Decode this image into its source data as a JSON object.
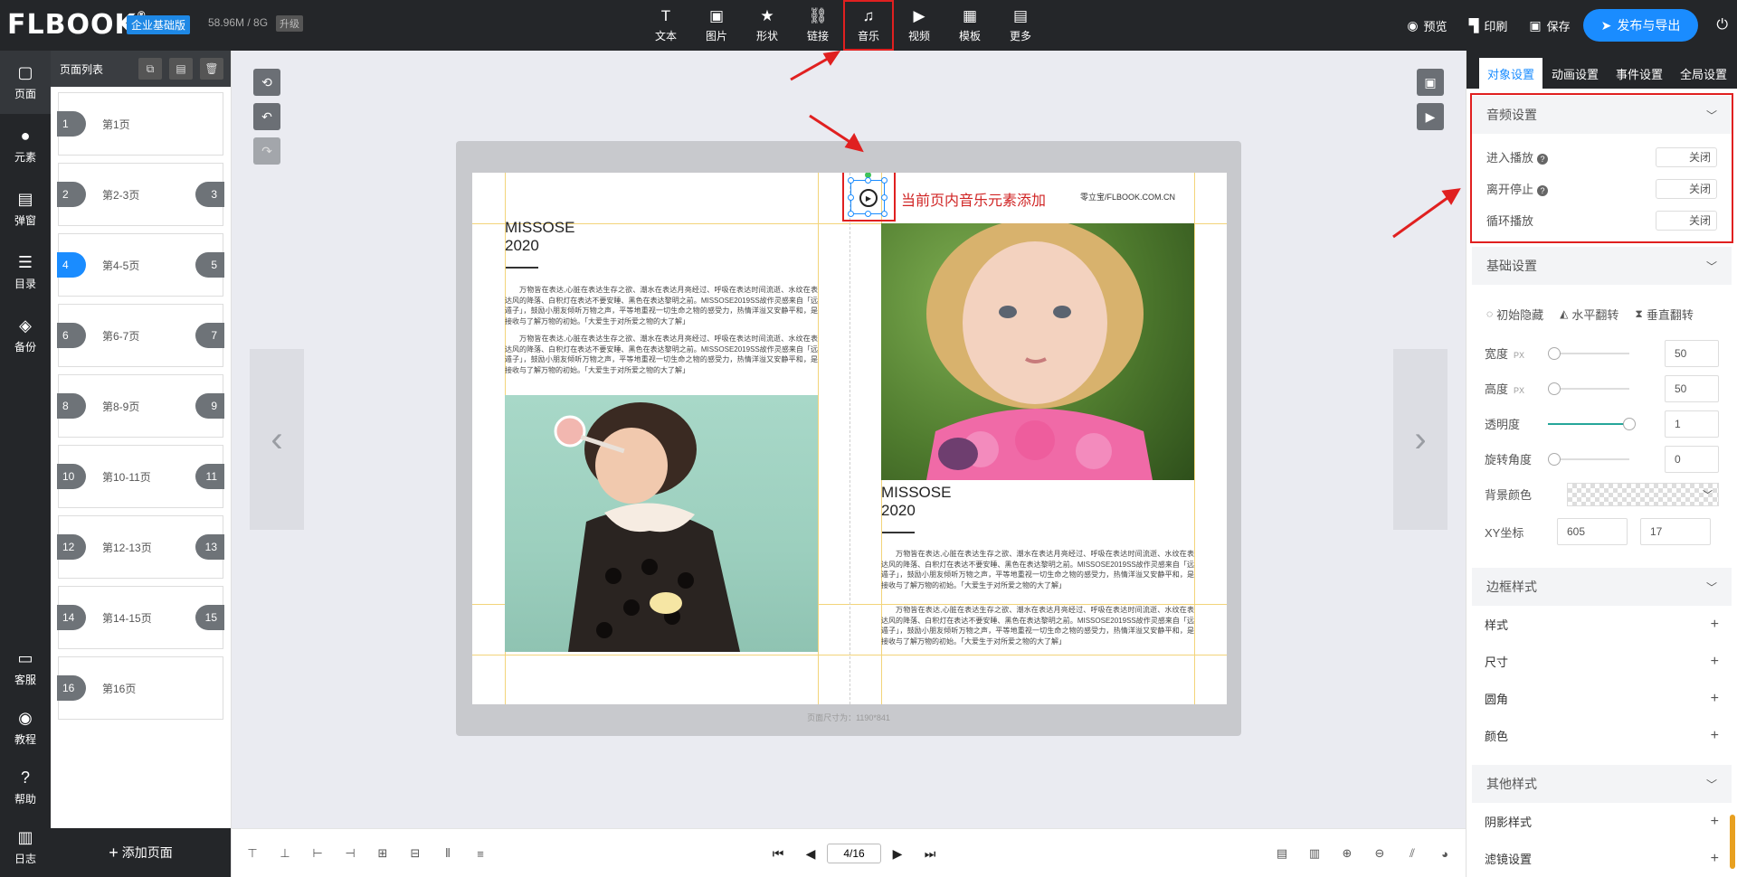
{
  "app": {
    "logo": "FLBOOK",
    "logo_mark": "®",
    "edition": "企业基础版",
    "storage": "58.96M / 8G",
    "upgrade": "升级"
  },
  "toolbar": {
    "items": [
      {
        "label": "文本",
        "icon": "text-icon",
        "glyph": "T"
      },
      {
        "label": "图片",
        "icon": "image-icon",
        "glyph": "▣"
      },
      {
        "label": "形状",
        "icon": "star-icon",
        "glyph": "★"
      },
      {
        "label": "链接",
        "icon": "link-icon",
        "glyph": "⛓"
      },
      {
        "label": "音乐",
        "icon": "music-icon",
        "glyph": "♫"
      },
      {
        "label": "视频",
        "icon": "video-icon",
        "glyph": "▶"
      },
      {
        "label": "模板",
        "icon": "template-icon",
        "glyph": "▦"
      },
      {
        "label": "更多",
        "icon": "more-icon",
        "glyph": "▤"
      }
    ],
    "preview": "预览",
    "print": "印刷",
    "save": "保存",
    "publish": "发布与导出"
  },
  "rail": {
    "top": [
      {
        "label": "页面",
        "icon": "page-icon",
        "glyph": "▢"
      },
      {
        "label": "元素",
        "icon": "elements-icon",
        "glyph": "●"
      },
      {
        "label": "弹窗",
        "icon": "popup-icon",
        "glyph": "▤"
      },
      {
        "label": "目录",
        "icon": "catalog-icon",
        "glyph": "☰"
      },
      {
        "label": "备份",
        "icon": "backup-icon",
        "glyph": "◈"
      }
    ],
    "bottom": [
      {
        "label": "客服",
        "icon": "service-icon",
        "glyph": "▭"
      },
      {
        "label": "教程",
        "icon": "tutorial-icon",
        "glyph": "◉"
      },
      {
        "label": "帮助",
        "icon": "help-icon",
        "glyph": "?"
      },
      {
        "label": "日志",
        "icon": "log-icon",
        "glyph": "▥"
      }
    ]
  },
  "pagelist": {
    "title": "页面列表",
    "items": [
      {
        "num": "1",
        "num2": "",
        "label": "第1页"
      },
      {
        "num": "2",
        "num2": "3",
        "label": "第2-3页"
      },
      {
        "num": "4",
        "num2": "5",
        "label": "第4-5页"
      },
      {
        "num": "6",
        "num2": "7",
        "label": "第6-7页"
      },
      {
        "num": "8",
        "num2": "9",
        "label": "第8-9页"
      },
      {
        "num": "10",
        "num2": "11",
        "label": "第10-11页"
      },
      {
        "num": "12",
        "num2": "13",
        "label": "第12-13页"
      },
      {
        "num": "14",
        "num2": "15",
        "label": "第14-15页"
      },
      {
        "num": "16",
        "num2": "",
        "label": "第16页"
      }
    ],
    "active_index": 2,
    "add_page": "添加页面"
  },
  "canvas": {
    "annotation": "当前页内音乐元素添加",
    "site": "零立宝/FLBOOK.COM.CN",
    "title_line1": "MISSOSE",
    "title_line2": "2020",
    "paragraph1": "万物皆在表达,心脏在表达生存之欲、潮水在表达月亮经过、呼吸在表达时间流逝、水纹在表达风的降落、白积灯在表达不要安睡、黑色在表达黎明之前。MISSOSE2019SS故作灵感来自「远遁子」，鼓励小朋友倾听万物之声，平等地重视一切生命之物的感受力，热情洋溢又安静平和，是接收与了解万物的初始。「大爱生于对所爱之物的大了解」",
    "paragraph2": "万物皆在表达,心脏在表达生存之欲、潮水在表达月亮经过、呼吸在表达时间流逝、水纹在表达风的降落、白积灯在表达不要安睡、黑色在表达黎明之前。MISSOSE2019SS故作灵感来自「远遁子」，鼓励小朋友倾听万物之声，平等地重视一切生命之物的感受力，热情洋溢又安静平和，是接收与了解万物的初始。「大爱生于对所爱之物的大了解」",
    "page_size": "页面尺寸为：1190*841"
  },
  "pager": {
    "current": "4/16"
  },
  "panel": {
    "tabs": [
      "对象设置",
      "动画设置",
      "事件设置",
      "全局设置"
    ],
    "audio": {
      "title": "音频设置",
      "rows": [
        {
          "label": "进入播放",
          "value": "关闭",
          "help": true
        },
        {
          "label": "离开停止",
          "value": "关闭",
          "help": true
        },
        {
          "label": "循环播放",
          "value": "关闭",
          "help": false
        }
      ]
    },
    "basic": {
      "title": "基础设置",
      "flips": [
        "初始隐藏",
        "水平翻转",
        "垂直翻转"
      ],
      "width_label": "宽度",
      "width_unit": "PX",
      "width": "50",
      "height_label": "高度",
      "height_unit": "PX",
      "height": "50",
      "opacity_label": "透明度",
      "opacity": "1",
      "rotate_label": "旋转角度",
      "rotate": "0",
      "bg_label": "背景颜色",
      "xy_label": "XY坐标",
      "x": "605",
      "y": "17"
    },
    "border": {
      "title": "边框样式",
      "rows": [
        "样式",
        "尺寸",
        "圆角",
        "颜色"
      ]
    },
    "other": {
      "title": "其他样式",
      "rows": [
        "阴影样式",
        "滤镜设置"
      ]
    }
  },
  "colors": {
    "accent": "#1a8cff",
    "dark": "#242629",
    "highlight": "#e02020"
  }
}
